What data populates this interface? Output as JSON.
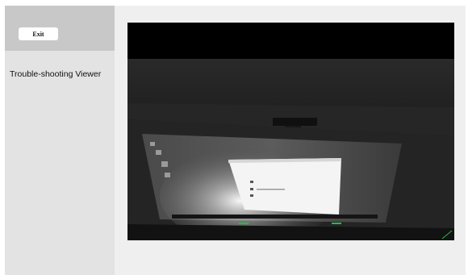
{
  "sidebar": {
    "exit_label": "Exit",
    "title": "Trouble-shooting Viewer"
  },
  "viewer": {
    "feed_description": "camera-feed"
  },
  "colors": {
    "sidebar_bg": "#e3e3e3",
    "sidebar_header_bg": "#c8c8c8",
    "main_bg": "#efefef",
    "camera_bg": "#000000",
    "indicator_green": "#1fbf3f"
  }
}
